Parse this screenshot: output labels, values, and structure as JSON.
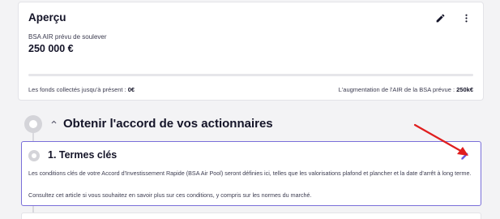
{
  "overview": {
    "title": "Aperçu",
    "metric_label": "BSA AIR prévu de soulever",
    "metric_value": "250 000 €",
    "progress_fraction": 0,
    "collected_label": "Les fonds collectés jusqu'à présent : ",
    "collected_value": "0€",
    "increase_label": "L'augmentation de l'AIR de la BSA prévue : ",
    "increase_value": "250k€"
  },
  "section": {
    "title": "Obtenir l'accord de vos actionnaires"
  },
  "step": {
    "title": "1.  Termes clés",
    "description": "Les conditions clés de votre Accord d'Investissement Rapide (BSA Air Pool) seront définies ici, telles que les valorisations plafond et plancher et la date d'arrêt à long terme.",
    "note": "Consultez cet article si vous souhaitez en savoir plus sur ces conditions, y compris sur les normes du marché."
  },
  "icons": {
    "overview_edit": "pencil-icon",
    "overview_more": "more-vertical-icon",
    "section_chevron": "chevron-up-icon",
    "step_edit": "pencil-icon",
    "annotation": "red-arrow"
  },
  "colors": {
    "accent": "#7a6fd9",
    "edit_icon": "#6a5ae0",
    "annotation_arrow": "#e01e1e",
    "background": "#f3f3f5"
  }
}
